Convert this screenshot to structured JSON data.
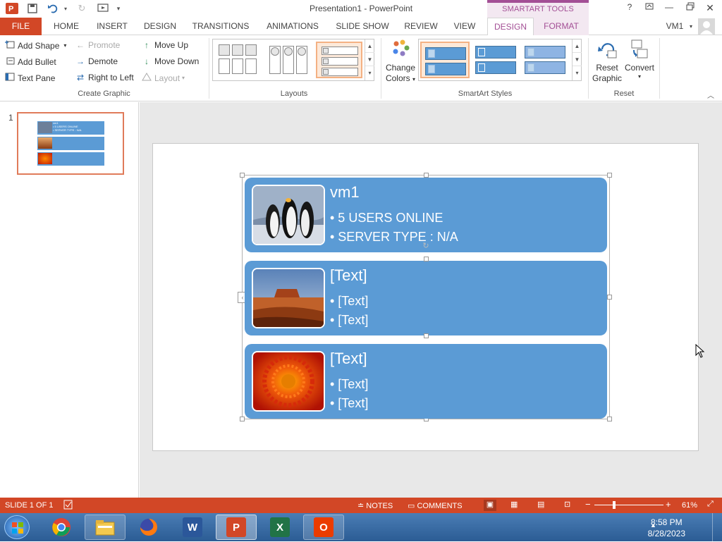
{
  "window": {
    "title": "Presentation1 - PowerPoint",
    "context_tab_group": "SMARTART TOOLS"
  },
  "tabs": [
    "FILE",
    "HOME",
    "INSERT",
    "DESIGN",
    "TRANSITIONS",
    "ANIMATIONS",
    "SLIDE SHOW",
    "REVIEW",
    "VIEW",
    "DESIGN",
    "FORMAT"
  ],
  "user": {
    "name": "VM1"
  },
  "ribbon": {
    "create_graphic": {
      "label": "Create Graphic",
      "add_shape": "Add Shape",
      "add_bullet": "Add Bullet",
      "text_pane": "Text Pane",
      "promote": "Promote",
      "demote": "Demote",
      "right_to_left": "Right to Left",
      "move_up": "Move Up",
      "move_down": "Move Down",
      "layout": "Layout"
    },
    "layouts": {
      "label": "Layouts"
    },
    "smartart_styles": {
      "label": "SmartArt Styles",
      "change_colors_line1": "Change",
      "change_colors_line2": "Colors"
    },
    "reset": {
      "label": "Reset",
      "reset_graphic_line1": "Reset",
      "reset_graphic_line2": "Graphic",
      "convert": "Convert"
    }
  },
  "thumbnail": {
    "number": "1",
    "rows": [
      "vm1",
      "",
      ""
    ],
    "row1_lines": [
      "• 5 USERS ONLINE",
      "• SERVER TYPE : N/A"
    ]
  },
  "smartart": {
    "rows": [
      {
        "heading": "vm1",
        "bullets": [
          "• 5 USERS ONLINE",
          "• SERVER TYPE : N/A"
        ],
        "picture": "penguins"
      },
      {
        "heading": "[Text]",
        "bullets": [
          "• [Text]",
          "• [Text]"
        ],
        "picture": "desert"
      },
      {
        "heading": "[Text]",
        "bullets": [
          "• [Text]",
          "• [Text]"
        ],
        "picture": "chrysanthemum"
      }
    ]
  },
  "status": {
    "slide": "SLIDE 1 OF 1",
    "notes": "NOTES",
    "comments": "COMMENTS",
    "zoom": "61%"
  },
  "taskbar": {
    "apps": [
      "start",
      "chrome",
      "file-explorer",
      "firefox",
      "word",
      "powerpoint",
      "excel",
      "office"
    ],
    "time": "8:58 PM",
    "date": "8/28/2023"
  },
  "colors": {
    "accent": "#d24726",
    "smartart_fill": "#5b9bd5",
    "context": "#a34f95"
  }
}
